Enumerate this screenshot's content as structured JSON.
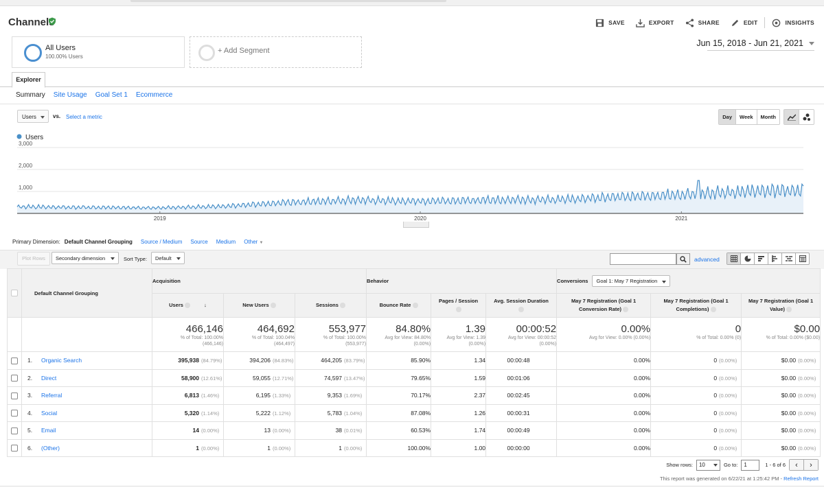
{
  "header": {
    "title": "Channels",
    "actions": {
      "save": "SAVE",
      "export": "EXPORT",
      "share": "SHARE",
      "edit": "EDIT",
      "insights": "INSIGHTS"
    }
  },
  "segments": {
    "all_users": {
      "name": "All Users",
      "sub": "100.00% Users"
    },
    "add_segment": "+ Add Segment"
  },
  "date_range": "Jun 15, 2018 - Jun 21, 2021",
  "explorer_tab": "Explorer",
  "subtabs": [
    "Summary",
    "Site Usage",
    "Goal Set 1",
    "Ecommerce"
  ],
  "metric": {
    "selected": "Users",
    "vs": "vs.",
    "select_metric": "Select a metric"
  },
  "periods": [
    "Day",
    "Week",
    "Month"
  ],
  "chart_data": {
    "type": "line",
    "legend": "Users",
    "y_ticks": [
      "3,000",
      "2,000",
      "1,000"
    ],
    "x_ticks": [
      "2019",
      "2020",
      "2021"
    ],
    "ylim": [
      0,
      3000
    ],
    "x_range": [
      "2018-06-15",
      "2021-06-21"
    ],
    "trend_users_per_day": [
      {
        "date": "2018-06-15",
        "value": 300
      },
      {
        "date": "2018-12-31",
        "value": 250
      },
      {
        "date": "2019-04-01",
        "value": 320
      },
      {
        "date": "2019-07-01",
        "value": 500
      },
      {
        "date": "2019-10-01",
        "value": 600
      },
      {
        "date": "2019-12-31",
        "value": 550
      },
      {
        "date": "2020-04-01",
        "value": 600
      },
      {
        "date": "2020-07-01",
        "value": 620
      },
      {
        "date": "2020-10-01",
        "value": 750
      },
      {
        "date": "2021-01-01",
        "value": 850
      },
      {
        "date": "2021-04-01",
        "value": 1000
      },
      {
        "date": "2021-06-21",
        "value": 1050
      }
    ],
    "peaks": [
      {
        "date": "2019-12-01",
        "value": 700
      },
      {
        "date": "2021-01-25",
        "value": 2000
      }
    ],
    "series_color": "#4a90c8"
  },
  "primary_dimension": {
    "label": "Primary Dimension:",
    "current": "Default Channel Grouping",
    "options": [
      "Source / Medium",
      "Source",
      "Medium",
      "Other"
    ]
  },
  "toolbar": {
    "plot_rows": "Plot Rows",
    "secondary_dimension": "Secondary dimension",
    "sort_type_label": "Sort Type:",
    "sort_type": "Default",
    "advanced": "advanced"
  },
  "table": {
    "group_headers": {
      "dimension": "Default Channel Grouping",
      "acquisition": "Acquisition",
      "behavior": "Behavior",
      "conversions": "Conversions",
      "goal_select": "Goal 1: May 7 Registration"
    },
    "columns": [
      "Users",
      "New Users",
      "Sessions",
      "Bounce Rate",
      "Pages / Session",
      "Avg. Session Duration",
      "May 7 Registration (Goal 1 Conversion Rate)",
      "May 7 Registration (Goal 1 Completions)",
      "May 7 Registration (Goal 1 Value)"
    ],
    "totals": [
      {
        "big": "466,146",
        "sub1": "% of Total: 100.00%",
        "sub2": "(466,146)"
      },
      {
        "big": "464,692",
        "sub1": "% of Total: 100.04%",
        "sub2": "(464,497)"
      },
      {
        "big": "553,977",
        "sub1": "% of Total: 100.00%",
        "sub2": "(553,977)"
      },
      {
        "big": "84.80%",
        "sub1": "Avg for View: 84.80%",
        "sub2": "(0.00%)"
      },
      {
        "big": "1.39",
        "sub1": "Avg for View: 1.39",
        "sub2": "(0.00%)"
      },
      {
        "big": "00:00:52",
        "sub1": "Avg for View: 00:00:52",
        "sub2": "(0.00%)"
      },
      {
        "big": "0.00%",
        "sub1": "Avg for View: 0.00% (0.00%)",
        "sub2": ""
      },
      {
        "big": "0",
        "sub1": "% of Total: 0.00% (0)",
        "sub2": ""
      },
      {
        "big": "$0.00",
        "sub1": "% of Total: 0.00% ($0.00)",
        "sub2": ""
      }
    ],
    "rows": [
      {
        "idx": "1.",
        "name": "Organic Search",
        "users": "395,938",
        "users_pct": "(84.79%)",
        "new_users": "394,206",
        "new_users_pct": "(84.83%)",
        "sessions": "464,205",
        "sessions_pct": "(83.79%)",
        "bounce": "85.90%",
        "pps": "1.34",
        "dur": "00:00:48",
        "conv_rate": "0.00%",
        "completions": "0",
        "completions_pct": "(0.00%)",
        "value": "$0.00",
        "value_pct": "(0.00%)"
      },
      {
        "idx": "2.",
        "name": "Direct",
        "users": "58,900",
        "users_pct": "(12.61%)",
        "new_users": "59,055",
        "new_users_pct": "(12.71%)",
        "sessions": "74,597",
        "sessions_pct": "(13.47%)",
        "bounce": "79.65%",
        "pps": "1.59",
        "dur": "00:01:06",
        "conv_rate": "0.00%",
        "completions": "0",
        "completions_pct": "(0.00%)",
        "value": "$0.00",
        "value_pct": "(0.00%)"
      },
      {
        "idx": "3.",
        "name": "Referral",
        "users": "6,813",
        "users_pct": "(1.46%)",
        "new_users": "6,195",
        "new_users_pct": "(1.33%)",
        "sessions": "9,353",
        "sessions_pct": "(1.69%)",
        "bounce": "70.17%",
        "pps": "2.37",
        "dur": "00:02:45",
        "conv_rate": "0.00%",
        "completions": "0",
        "completions_pct": "(0.00%)",
        "value": "$0.00",
        "value_pct": "(0.00%)"
      },
      {
        "idx": "4.",
        "name": "Social",
        "users": "5,320",
        "users_pct": "(1.14%)",
        "new_users": "5,222",
        "new_users_pct": "(1.12%)",
        "sessions": "5,783",
        "sessions_pct": "(1.04%)",
        "bounce": "87.08%",
        "pps": "1.26",
        "dur": "00:00:31",
        "conv_rate": "0.00%",
        "completions": "0",
        "completions_pct": "(0.00%)",
        "value": "$0.00",
        "value_pct": "(0.00%)"
      },
      {
        "idx": "5.",
        "name": "Email",
        "users": "14",
        "users_pct": "(0.00%)",
        "new_users": "13",
        "new_users_pct": "(0.00%)",
        "sessions": "38",
        "sessions_pct": "(0.01%)",
        "bounce": "60.53%",
        "pps": "1.74",
        "dur": "00:00:49",
        "conv_rate": "0.00%",
        "completions": "0",
        "completions_pct": "(0.00%)",
        "value": "$0.00",
        "value_pct": "(0.00%)"
      },
      {
        "idx": "6.",
        "name": "(Other)",
        "users": "1",
        "users_pct": "(0.00%)",
        "new_users": "1",
        "new_users_pct": "(0.00%)",
        "sessions": "1",
        "sessions_pct": "(0.00%)",
        "bounce": "100.00%",
        "pps": "1.00",
        "dur": "00:00:00",
        "conv_rate": "0.00%",
        "completions": "0",
        "completions_pct": "(0.00%)",
        "value": "$0.00",
        "value_pct": "(0.00%)"
      }
    ]
  },
  "pagination": {
    "show_rows_label": "Show rows:",
    "show_rows": "10",
    "goto_label": "Go to:",
    "goto": "1",
    "range": "1 - 6 of 6"
  },
  "footer": {
    "generated": "This report was generated on 6/22/21 at 1:25:42 PM - ",
    "refresh": "Refresh Report"
  },
  "colors": {
    "accent": "#1a73e8",
    "series": "#4a90c8",
    "verified": "#3c9a4a"
  }
}
